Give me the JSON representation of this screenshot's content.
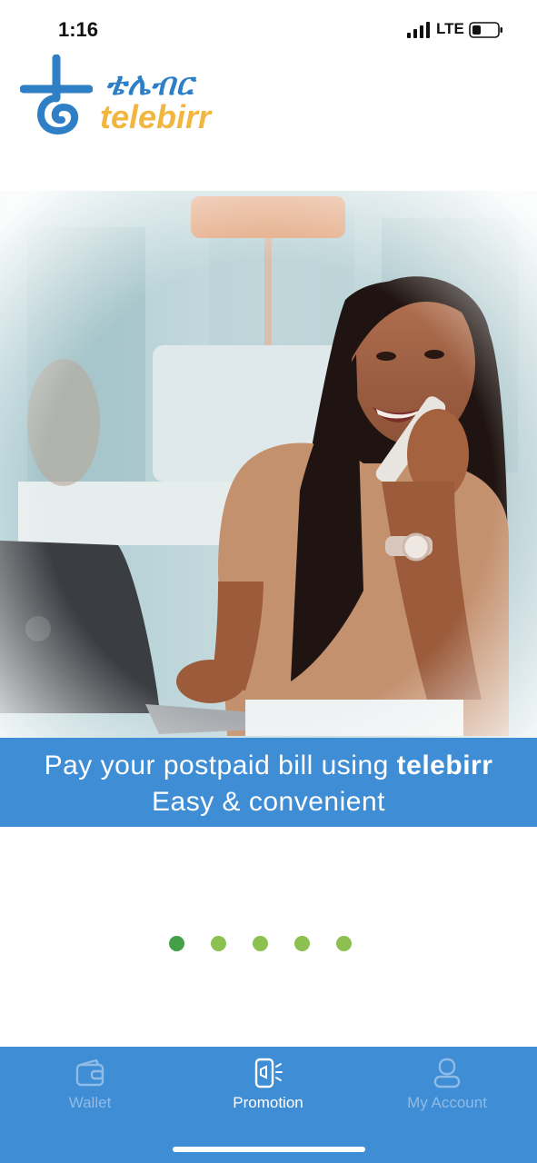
{
  "status_bar": {
    "time": "1:16",
    "network": "LTE",
    "icons": [
      "signal-icon",
      "battery-icon"
    ]
  },
  "logo": {
    "amharic": "ቴሌብር",
    "latin": "telebirr",
    "colors": {
      "blue": "#2f7fc6",
      "gold": "#f0b640"
    }
  },
  "promo": {
    "line1_prefix": "Pay your postpaid bill using ",
    "line1_brand": "telebirr",
    "line2": "Easy & convenient",
    "banner_color": "#3f8dd4"
  },
  "pager": {
    "count": 5,
    "active_index": 0,
    "active_color": "#43a047",
    "inactive_color": "#8cc152"
  },
  "bottom_nav": {
    "items": [
      {
        "label": "Wallet",
        "icon": "wallet-icon",
        "active": false
      },
      {
        "label": "Promotion",
        "icon": "promotion-icon",
        "active": true
      },
      {
        "label": "My Account",
        "icon": "account-icon",
        "active": false
      }
    ],
    "background": "#3f8dd4"
  }
}
